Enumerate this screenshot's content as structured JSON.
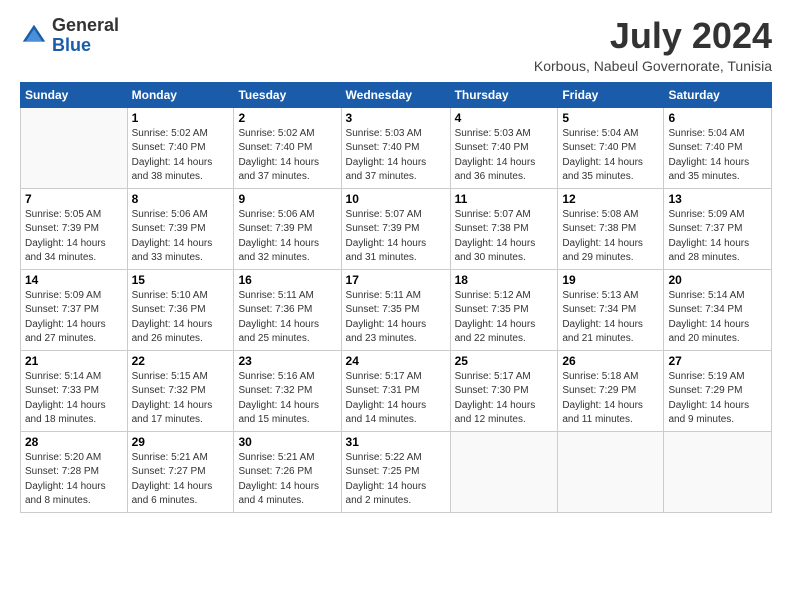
{
  "logo": {
    "general": "General",
    "blue": "Blue"
  },
  "title": {
    "month_year": "July 2024",
    "location": "Korbous, Nabeul Governorate, Tunisia"
  },
  "days_of_week": [
    "Sunday",
    "Monday",
    "Tuesday",
    "Wednesday",
    "Thursday",
    "Friday",
    "Saturday"
  ],
  "weeks": [
    [
      {
        "day": "",
        "info": ""
      },
      {
        "day": "1",
        "info": "Sunrise: 5:02 AM\nSunset: 7:40 PM\nDaylight: 14 hours\nand 38 minutes."
      },
      {
        "day": "2",
        "info": "Sunrise: 5:02 AM\nSunset: 7:40 PM\nDaylight: 14 hours\nand 37 minutes."
      },
      {
        "day": "3",
        "info": "Sunrise: 5:03 AM\nSunset: 7:40 PM\nDaylight: 14 hours\nand 37 minutes."
      },
      {
        "day": "4",
        "info": "Sunrise: 5:03 AM\nSunset: 7:40 PM\nDaylight: 14 hours\nand 36 minutes."
      },
      {
        "day": "5",
        "info": "Sunrise: 5:04 AM\nSunset: 7:40 PM\nDaylight: 14 hours\nand 35 minutes."
      },
      {
        "day": "6",
        "info": "Sunrise: 5:04 AM\nSunset: 7:40 PM\nDaylight: 14 hours\nand 35 minutes."
      }
    ],
    [
      {
        "day": "7",
        "info": "Sunrise: 5:05 AM\nSunset: 7:39 PM\nDaylight: 14 hours\nand 34 minutes."
      },
      {
        "day": "8",
        "info": "Sunrise: 5:06 AM\nSunset: 7:39 PM\nDaylight: 14 hours\nand 33 minutes."
      },
      {
        "day": "9",
        "info": "Sunrise: 5:06 AM\nSunset: 7:39 PM\nDaylight: 14 hours\nand 32 minutes."
      },
      {
        "day": "10",
        "info": "Sunrise: 5:07 AM\nSunset: 7:39 PM\nDaylight: 14 hours\nand 31 minutes."
      },
      {
        "day": "11",
        "info": "Sunrise: 5:07 AM\nSunset: 7:38 PM\nDaylight: 14 hours\nand 30 minutes."
      },
      {
        "day": "12",
        "info": "Sunrise: 5:08 AM\nSunset: 7:38 PM\nDaylight: 14 hours\nand 29 minutes."
      },
      {
        "day": "13",
        "info": "Sunrise: 5:09 AM\nSunset: 7:37 PM\nDaylight: 14 hours\nand 28 minutes."
      }
    ],
    [
      {
        "day": "14",
        "info": "Sunrise: 5:09 AM\nSunset: 7:37 PM\nDaylight: 14 hours\nand 27 minutes."
      },
      {
        "day": "15",
        "info": "Sunrise: 5:10 AM\nSunset: 7:36 PM\nDaylight: 14 hours\nand 26 minutes."
      },
      {
        "day": "16",
        "info": "Sunrise: 5:11 AM\nSunset: 7:36 PM\nDaylight: 14 hours\nand 25 minutes."
      },
      {
        "day": "17",
        "info": "Sunrise: 5:11 AM\nSunset: 7:35 PM\nDaylight: 14 hours\nand 23 minutes."
      },
      {
        "day": "18",
        "info": "Sunrise: 5:12 AM\nSunset: 7:35 PM\nDaylight: 14 hours\nand 22 minutes."
      },
      {
        "day": "19",
        "info": "Sunrise: 5:13 AM\nSunset: 7:34 PM\nDaylight: 14 hours\nand 21 minutes."
      },
      {
        "day": "20",
        "info": "Sunrise: 5:14 AM\nSunset: 7:34 PM\nDaylight: 14 hours\nand 20 minutes."
      }
    ],
    [
      {
        "day": "21",
        "info": "Sunrise: 5:14 AM\nSunset: 7:33 PM\nDaylight: 14 hours\nand 18 minutes."
      },
      {
        "day": "22",
        "info": "Sunrise: 5:15 AM\nSunset: 7:32 PM\nDaylight: 14 hours\nand 17 minutes."
      },
      {
        "day": "23",
        "info": "Sunrise: 5:16 AM\nSunset: 7:32 PM\nDaylight: 14 hours\nand 15 minutes."
      },
      {
        "day": "24",
        "info": "Sunrise: 5:17 AM\nSunset: 7:31 PM\nDaylight: 14 hours\nand 14 minutes."
      },
      {
        "day": "25",
        "info": "Sunrise: 5:17 AM\nSunset: 7:30 PM\nDaylight: 14 hours\nand 12 minutes."
      },
      {
        "day": "26",
        "info": "Sunrise: 5:18 AM\nSunset: 7:29 PM\nDaylight: 14 hours\nand 11 minutes."
      },
      {
        "day": "27",
        "info": "Sunrise: 5:19 AM\nSunset: 7:29 PM\nDaylight: 14 hours\nand 9 minutes."
      }
    ],
    [
      {
        "day": "28",
        "info": "Sunrise: 5:20 AM\nSunset: 7:28 PM\nDaylight: 14 hours\nand 8 minutes."
      },
      {
        "day": "29",
        "info": "Sunrise: 5:21 AM\nSunset: 7:27 PM\nDaylight: 14 hours\nand 6 minutes."
      },
      {
        "day": "30",
        "info": "Sunrise: 5:21 AM\nSunset: 7:26 PM\nDaylight: 14 hours\nand 4 minutes."
      },
      {
        "day": "31",
        "info": "Sunrise: 5:22 AM\nSunset: 7:25 PM\nDaylight: 14 hours\nand 2 minutes."
      },
      {
        "day": "",
        "info": ""
      },
      {
        "day": "",
        "info": ""
      },
      {
        "day": "",
        "info": ""
      }
    ]
  ]
}
